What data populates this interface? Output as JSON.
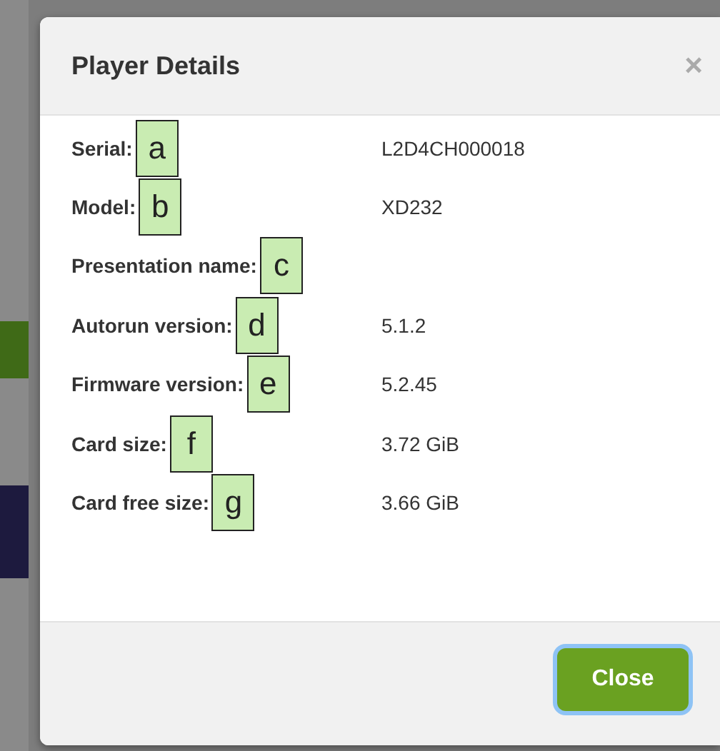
{
  "dialog": {
    "title": "Player Details",
    "close_icon": "×"
  },
  "details": [
    {
      "label": "Serial:",
      "marker": "a",
      "value": "L2D4CH000018"
    },
    {
      "label": "Model:",
      "marker": "b",
      "value": "XD232"
    },
    {
      "label": "Presentation name:",
      "marker": "c"
    },
    {
      "label": "Autorun version:",
      "marker": "d",
      "value": "5.1.2"
    },
    {
      "label": "Firmware version:",
      "marker": "e",
      "value": "5.2.45"
    },
    {
      "label": "Card size:",
      "marker": "f",
      "value": "3.72 GiB"
    },
    {
      "label": "Card free size:",
      "marker": "g",
      "value": "3.66 GiB"
    }
  ],
  "buttons": [
    {
      "label": "Close",
      "focused": true
    }
  ]
}
